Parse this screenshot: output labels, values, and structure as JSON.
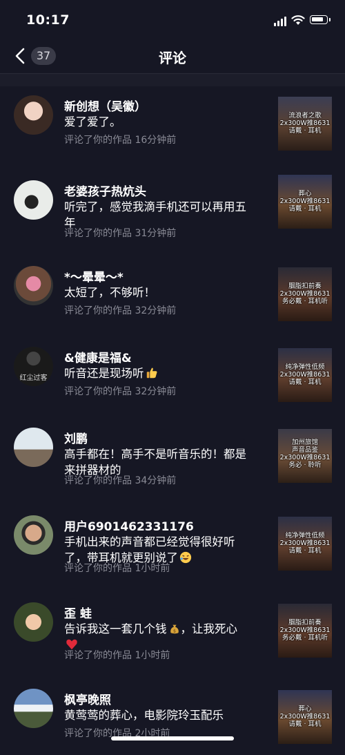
{
  "status_bar": {
    "time": "10:17"
  },
  "nav": {
    "count": "37",
    "title": "评论"
  },
  "comments": [
    {
      "name": "新创想（吴徽）",
      "lines": [
        "爱了爱了。"
      ],
      "meta": "评论了你的作品  16分钟前",
      "thumb": {
        "cap": [
          "流浪者之歌",
          "2x300W推8631",
          "请戴 · 耳机"
        ]
      }
    },
    {
      "name": "老婆孩子热炕头",
      "lines": [
        "听完了，感觉我滴手机还可以再用五",
        "年"
      ],
      "meta": "评论了你的作品  31分钟前",
      "thumb": {
        "cap": [
          "葬心",
          "2x300W推8631",
          "请戴 · 耳机"
        ]
      }
    },
    {
      "name": "*～晕晕～*",
      "lines": [
        "太短了，不够听！"
      ],
      "meta": "评论了你的作品  32分钟前",
      "thumb": {
        "cap": [
          "胭脂扣前奏",
          "2x300W推8631",
          "务必戴 · 耳机听"
        ]
      }
    },
    {
      "name": "&健康是福&",
      "lines": [
        "听音还是现场听"
      ],
      "meta": "评论了你的作品  32分钟前",
      "thumb": {
        "cap": [
          "纯净弹性低频",
          "2x300W推8631",
          "请戴 · 耳机"
        ]
      },
      "avatar_text": "红尘过客"
    },
    {
      "name": "刘鹏",
      "lines": [
        "高手都在！高手不是听音乐的！都是",
        "来拼器材的"
      ],
      "meta": "评论了你的作品  34分钟前",
      "thumb": {
        "cap": [
          "加州旅馆",
          "声音品鉴",
          "2x300W推8631",
          "务必 · 聆听"
        ]
      }
    },
    {
      "name": "用户6901462331176",
      "lines": [
        "手机出来的声音都已经觉得很好听",
        "了，带耳机就更别说了"
      ],
      "meta": "评论了你的作品  1小时前",
      "thumb": {
        "cap": [
          "纯净弹性低频",
          "2x300W推8631",
          "请戴 · 耳机"
        ]
      }
    },
    {
      "name": "歪 蛙",
      "lines": [
        "告诉我这一套几个钱",
        ""
      ],
      "meta": "评论了你的作品  1小时前",
      "thumb": {
        "cap": [
          "胭脂扣前奏",
          "2x300W推8631",
          "务必戴 · 耳机听"
        ]
      },
      "text_after_emoji": "，让我死心"
    },
    {
      "name": "枫亭晚照",
      "lines": [
        "黄莺莺的葬心，电影院玲玉配乐"
      ],
      "meta": "评论了你的作品  2小时前",
      "thumb": {
        "cap": [
          "葬心",
          "2x300W推8631",
          "请戴 · 耳机"
        ]
      }
    }
  ],
  "colors": {
    "background": "#161724",
    "meta": "#8a8b96",
    "badge": "#3a3b48"
  },
  "icons": [
    "back-chevron-icon",
    "signal-icon",
    "wifi-icon",
    "battery-icon",
    "thumbs-up-emoji",
    "laughing-emoji",
    "money-bag-emoji",
    "heart-emoji"
  ]
}
